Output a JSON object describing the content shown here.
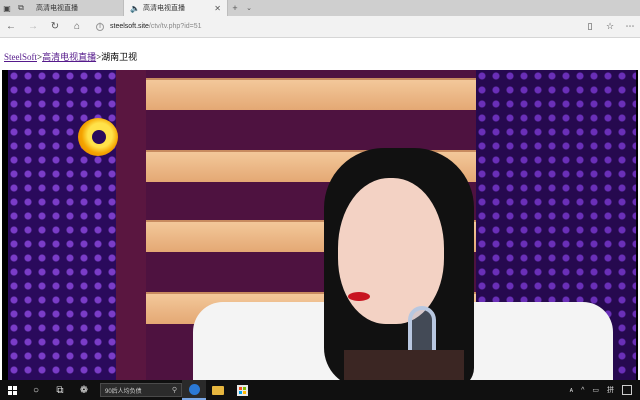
{
  "browser": {
    "tabs": [
      {
        "label": "高清电视直播",
        "active": false
      },
      {
        "label": "高清电视直播",
        "active": true,
        "audio": true
      }
    ],
    "url": {
      "domain": "steelsoft.site",
      "path": "/ctv/tv.php?id=51"
    },
    "icons": {
      "back": "arrow-left-icon",
      "forward": "arrow-right-icon",
      "refresh": "refresh-icon",
      "home": "home-icon",
      "favorite": "star-icon",
      "menu": "more-icon"
    }
  },
  "breadcrumb": {
    "site": "SteelSoft",
    "sep1": ">",
    "section": "高清电视直播",
    "sep2": ">",
    "current": "湖南卫视"
  },
  "video": {
    "channel_logo": "mango-tv-logo"
  },
  "taskbar": {
    "search_text": "90后人均负债",
    "ime_label": "拼",
    "colors": {
      "background": "#101010",
      "accent": "#2b79d6"
    }
  }
}
